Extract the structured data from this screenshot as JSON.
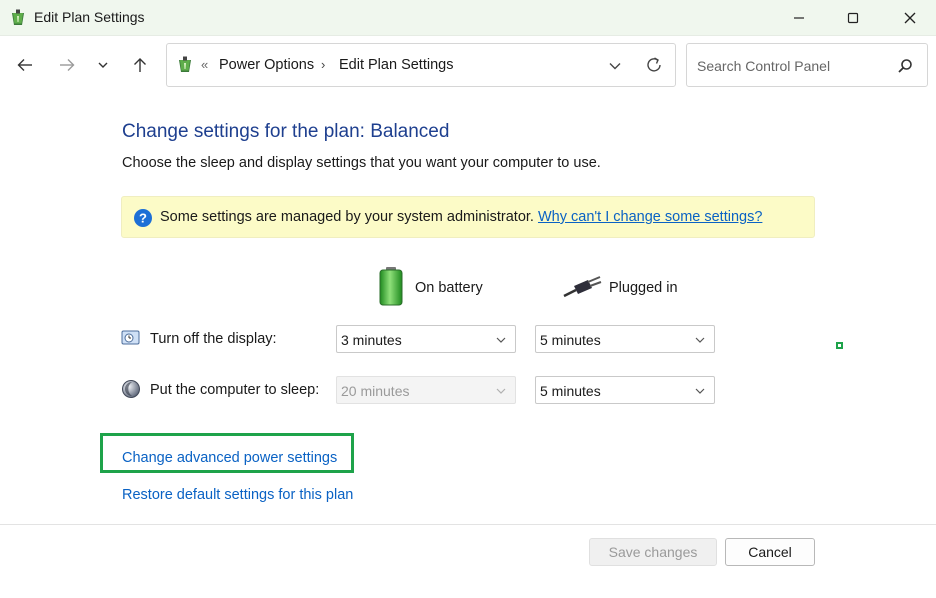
{
  "window": {
    "title": "Edit Plan Settings",
    "controls": [
      "minimize",
      "maximize",
      "close"
    ]
  },
  "nav": {
    "back_icon": "arrow-left-icon",
    "forward_icon": "arrow-right-icon",
    "recent_icon": "chevron-down-icon",
    "up_icon": "arrow-up-icon"
  },
  "address": {
    "lead_separator": "«",
    "breadcrumbs": [
      "Power Options",
      "Edit Plan Settings"
    ],
    "separator": "›"
  },
  "search": {
    "placeholder": "Search Control Panel"
  },
  "main": {
    "heading": "Change settings for the plan: Balanced",
    "subtext": "Choose the sleep and display settings that you want your computer to use.",
    "info": {
      "text": "Some settings are managed by your system administrator. ",
      "link": "Why can't I change some settings?"
    },
    "columns": {
      "battery": "On battery",
      "plugged": "Plugged in"
    },
    "rows": [
      {
        "label": "Turn off the display:",
        "battery_value": "3 minutes",
        "plugged_value": "5 minutes",
        "battery_disabled": false
      },
      {
        "label": "Put the computer to sleep:",
        "battery_value": "20 minutes",
        "plugged_value": "5 minutes",
        "battery_disabled": true
      }
    ],
    "links": {
      "advanced": "Change advanced power settings",
      "restore": "Restore default settings for this plan"
    }
  },
  "footer": {
    "save_label": "Save changes",
    "cancel_label": "Cancel"
  },
  "colors": {
    "title_bar_bg": "#f0f7ee",
    "heading": "#1e3f8f",
    "link": "#0a62c4",
    "info_bg": "#fcfbc7",
    "highlight": "#1ea34a"
  }
}
